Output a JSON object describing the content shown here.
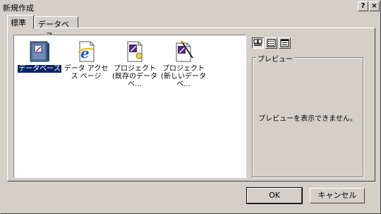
{
  "window": {
    "title": "新規作成"
  },
  "titlebar": {
    "help_label": "?",
    "close_label": "×"
  },
  "tabs": [
    {
      "label": "標準",
      "active": true
    },
    {
      "label": "データベース",
      "active": false
    }
  ],
  "items": [
    {
      "label": "データベース",
      "icon": "database-icon",
      "selected": true
    },
    {
      "label": "データ アクセス ページ",
      "icon": "ie-page-icon",
      "selected": false
    },
    {
      "label": "プロジェクト (既存のデータベ...",
      "icon": "project-existing-icon",
      "selected": false
    },
    {
      "label": "プロジェクト (新しいデータベ...",
      "icon": "project-new-icon",
      "selected": false
    }
  ],
  "view_buttons": [
    {
      "name": "large-icons-view",
      "pressed": true
    },
    {
      "name": "list-view",
      "pressed": false
    },
    {
      "name": "details-view",
      "pressed": false
    }
  ],
  "preview": {
    "label": "プレビュー",
    "message": "プレビューを表示できません。"
  },
  "buttons": {
    "ok_label": "OK",
    "cancel_label": "キャンセル"
  },
  "colors": {
    "selection": "#0a246a",
    "face": "#d4d0c8"
  }
}
